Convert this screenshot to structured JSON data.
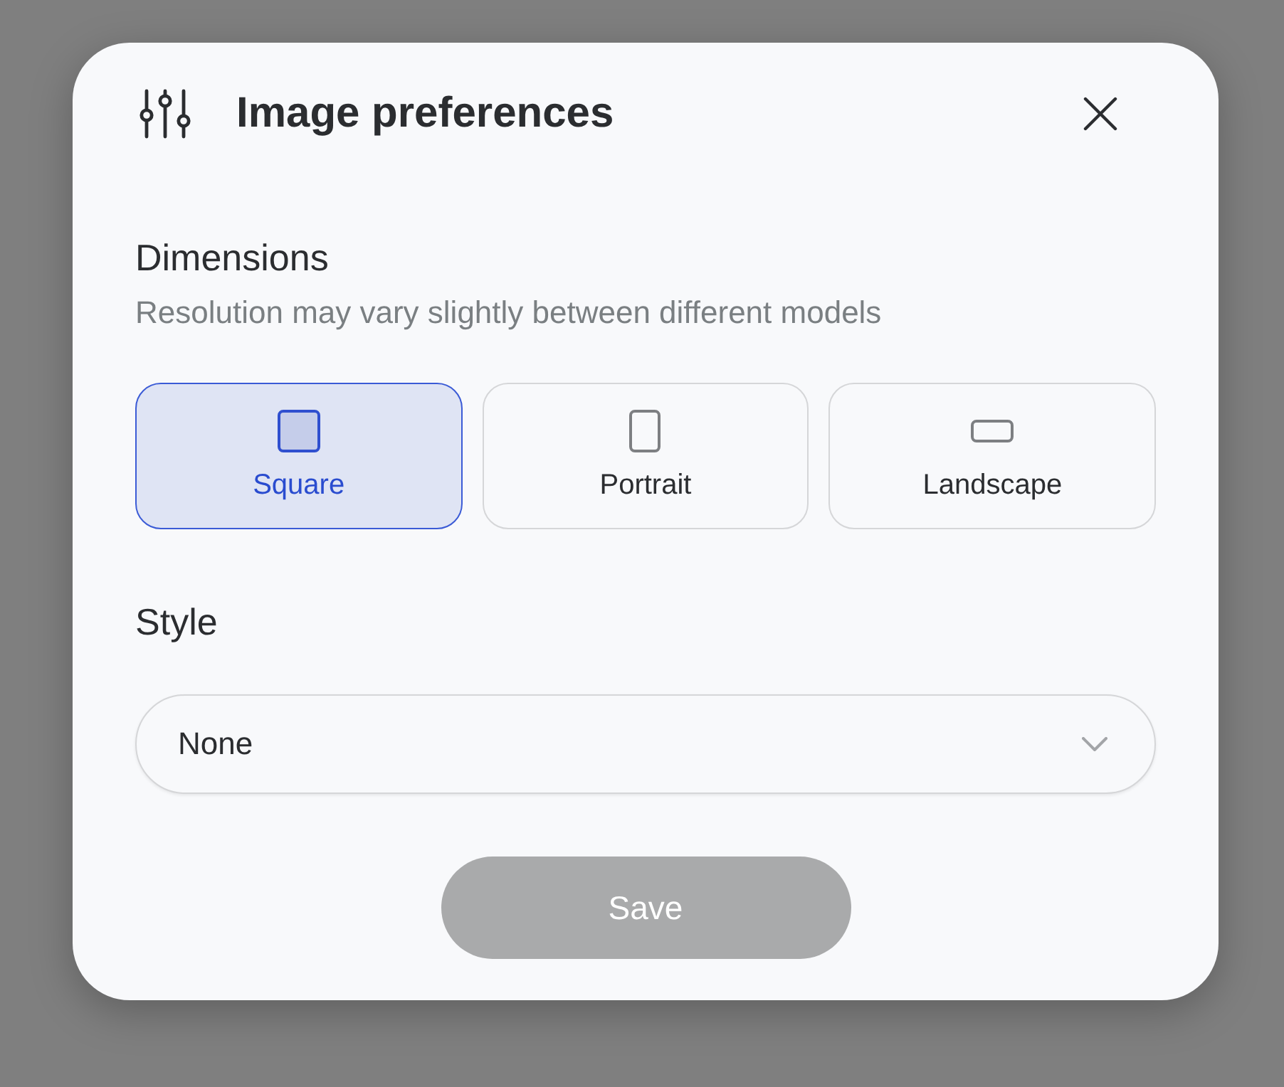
{
  "dialog": {
    "title": "Image preferences"
  },
  "dimensions": {
    "label": "Dimensions",
    "hint": "Resolution may vary slightly between different models",
    "options": [
      {
        "label": "Square",
        "kind": "square",
        "selected": true
      },
      {
        "label": "Portrait",
        "kind": "portrait",
        "selected": false
      },
      {
        "label": "Landscape",
        "kind": "landscape",
        "selected": false
      }
    ]
  },
  "style": {
    "label": "Style",
    "value": "None"
  },
  "save_button": {
    "label": "Save",
    "disabled": true
  }
}
